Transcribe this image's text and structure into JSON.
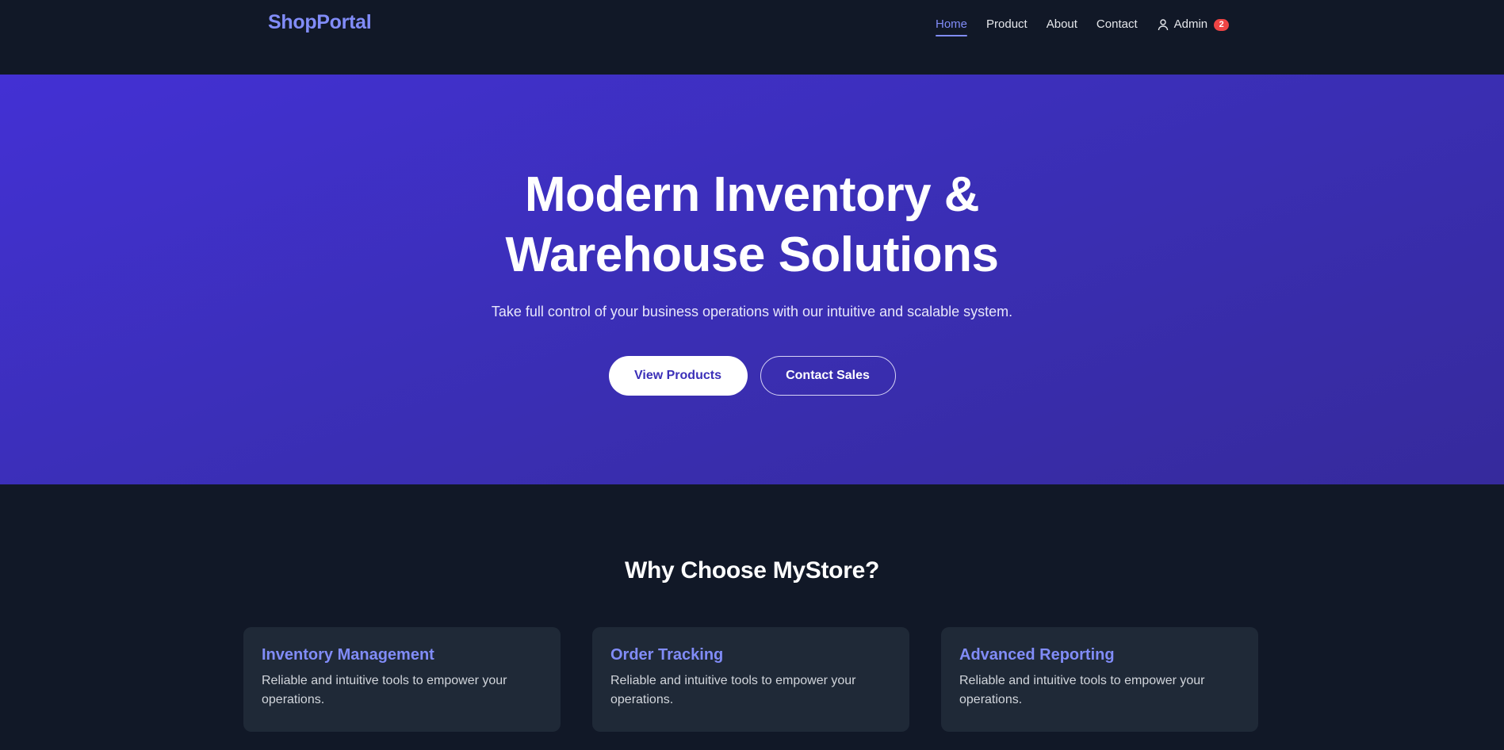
{
  "navbar": {
    "brand": "ShopPortal",
    "links": [
      {
        "label": "Home",
        "active": true
      },
      {
        "label": "Product",
        "active": false
      },
      {
        "label": "About",
        "active": false
      },
      {
        "label": "Contact",
        "active": false
      }
    ],
    "user": {
      "icon": "user-icon",
      "label": "Admin",
      "badge": "2"
    }
  },
  "hero": {
    "title_line1": "Modern Inventory &",
    "title_line2": "Warehouse Solutions",
    "subtitle": "Take full control of your business operations with our intuitive and scalable system.",
    "primary_button": "View Products",
    "secondary_button": "Contact Sales"
  },
  "features": {
    "title": "Why Choose MyStore?",
    "cards": [
      {
        "title": "Inventory Management",
        "text": "Reliable and intuitive tools to empower your operations."
      },
      {
        "title": "Order Tracking",
        "text": "Reliable and intuitive tools to empower your operations."
      },
      {
        "title": "Advanced Reporting",
        "text": "Reliable and intuitive tools to empower your operations."
      }
    ]
  },
  "colors": {
    "background": "#111827",
    "accent": "#818cf8",
    "hero_gradient_start": "#4330d4",
    "hero_gradient_end": "#362a9c",
    "card": "#1f2937",
    "badge": "#ef4444"
  }
}
